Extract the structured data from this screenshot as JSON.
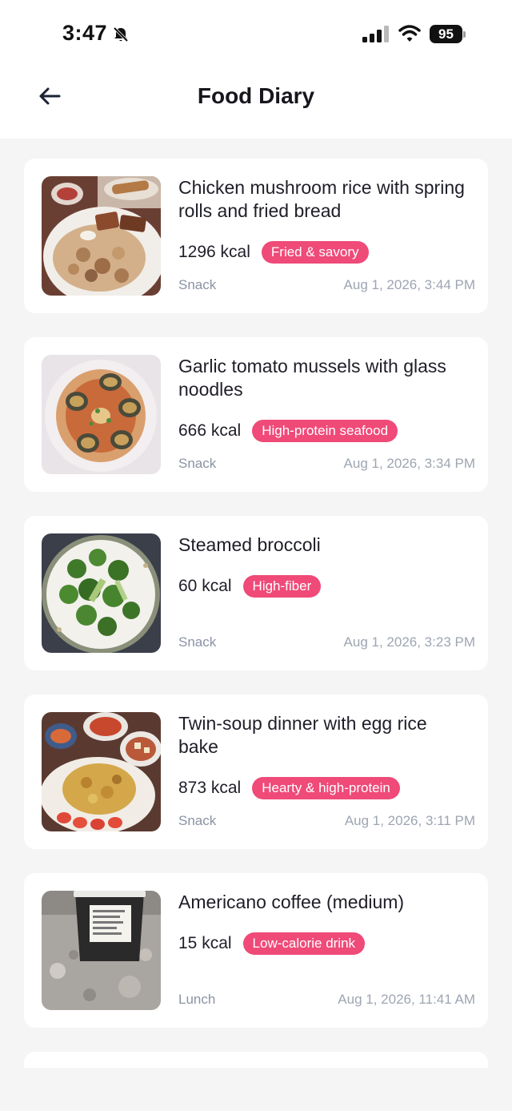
{
  "status_bar": {
    "time": "3:47",
    "battery": "95"
  },
  "header": {
    "title": "Food Diary"
  },
  "entries": [
    {
      "name": "Chicken mushroom rice with spring rolls and fried bread",
      "kcal": "1296 kcal",
      "tag": "Fried & savory",
      "meal": "Snack",
      "datetime": "Aug 1, 2026, 3:44 PM"
    },
    {
      "name": "Garlic tomato mussels with glass noodles",
      "kcal": "666 kcal",
      "tag": "High-protein seafood",
      "meal": "Snack",
      "datetime": "Aug 1, 2026, 3:34 PM"
    },
    {
      "name": "Steamed broccoli",
      "kcal": "60 kcal",
      "tag": "High-fiber",
      "meal": "Snack",
      "datetime": "Aug 1, 2026, 3:23 PM"
    },
    {
      "name": "Twin-soup dinner with egg rice bake",
      "kcal": "873 kcal",
      "tag": "Hearty & high-protein",
      "meal": "Snack",
      "datetime": "Aug 1, 2026, 3:11 PM"
    },
    {
      "name": "Americano coffee (medium)",
      "kcal": "15 kcal",
      "tag": "Low-calorie drink",
      "meal": "Lunch",
      "datetime": "Aug 1, 2026, 11:41 AM"
    }
  ],
  "colors": {
    "accent_tag": "#ef4a78",
    "background": "#f5f5f6"
  }
}
